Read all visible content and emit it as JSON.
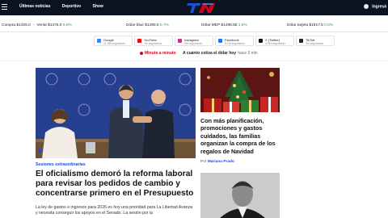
{
  "header": {
    "nav": [
      "Últimas noticias",
      "Deportivo",
      "Show"
    ],
    "logo_text": "TN",
    "login_label": "Ingresá"
  },
  "dollar": {
    "items": [
      {
        "label": "Compra $1425.0",
        "label2": "Venta $1475.0",
        "pct": "0.0%"
      },
      {
        "label": "Dólar blue $1490.0",
        "pct": "0.7%"
      },
      {
        "label": "Dólar MEP $1498.58",
        "pct": "1.0%"
      },
      {
        "label": "Dólar tarjeta $1917.5",
        "pct": "0.0%"
      }
    ]
  },
  "social": [
    {
      "name": "Google",
      "count": "31.3M seguidores",
      "icon": "google-icon"
    },
    {
      "name": "YouTube",
      "count": "7M seguidores",
      "icon": "youtube-icon"
    },
    {
      "name": "Instagram",
      "count": "5M seguidores",
      "icon": "instagram-icon"
    },
    {
      "name": "Facebook",
      "count": "8.1M seguidores",
      "icon": "facebook-icon"
    },
    {
      "name": "X (Twitter)",
      "count": "4.8M seguidores",
      "icon": "x-icon"
    },
    {
      "name": "TikTok",
      "count": "3M seguidores",
      "icon": "tiktok-icon"
    }
  ],
  "ticker": {
    "live_label": "Minuto a minuto",
    "headline": "A cuánto cotiza el dólar hoy",
    "time": "hace 5 min"
  },
  "main": {
    "kicker": "Sesiones extraordinarias",
    "headline": "El oficialismo demoró la reforma laboral para revisar los pedidos de cambio y concentrarse primero en el Presupuesto",
    "summary": "La ley de gastos e ingresos para 2026 es hoy una prioridad para La Libertad Avanza y necesita conseguir los apoyos en el Senado. La sesión por la"
  },
  "side": {
    "headline": "Con más planificación, promociones y gastos cuidados, las familias organizan la compra de los regalos de Navidad",
    "by_prefix": "Por",
    "author": "Mariana Prado"
  },
  "colors": {
    "accent": "#1e4fd1",
    "live": "#d0021b",
    "topbar": "#0b1220",
    "up": "#1f9d55"
  }
}
